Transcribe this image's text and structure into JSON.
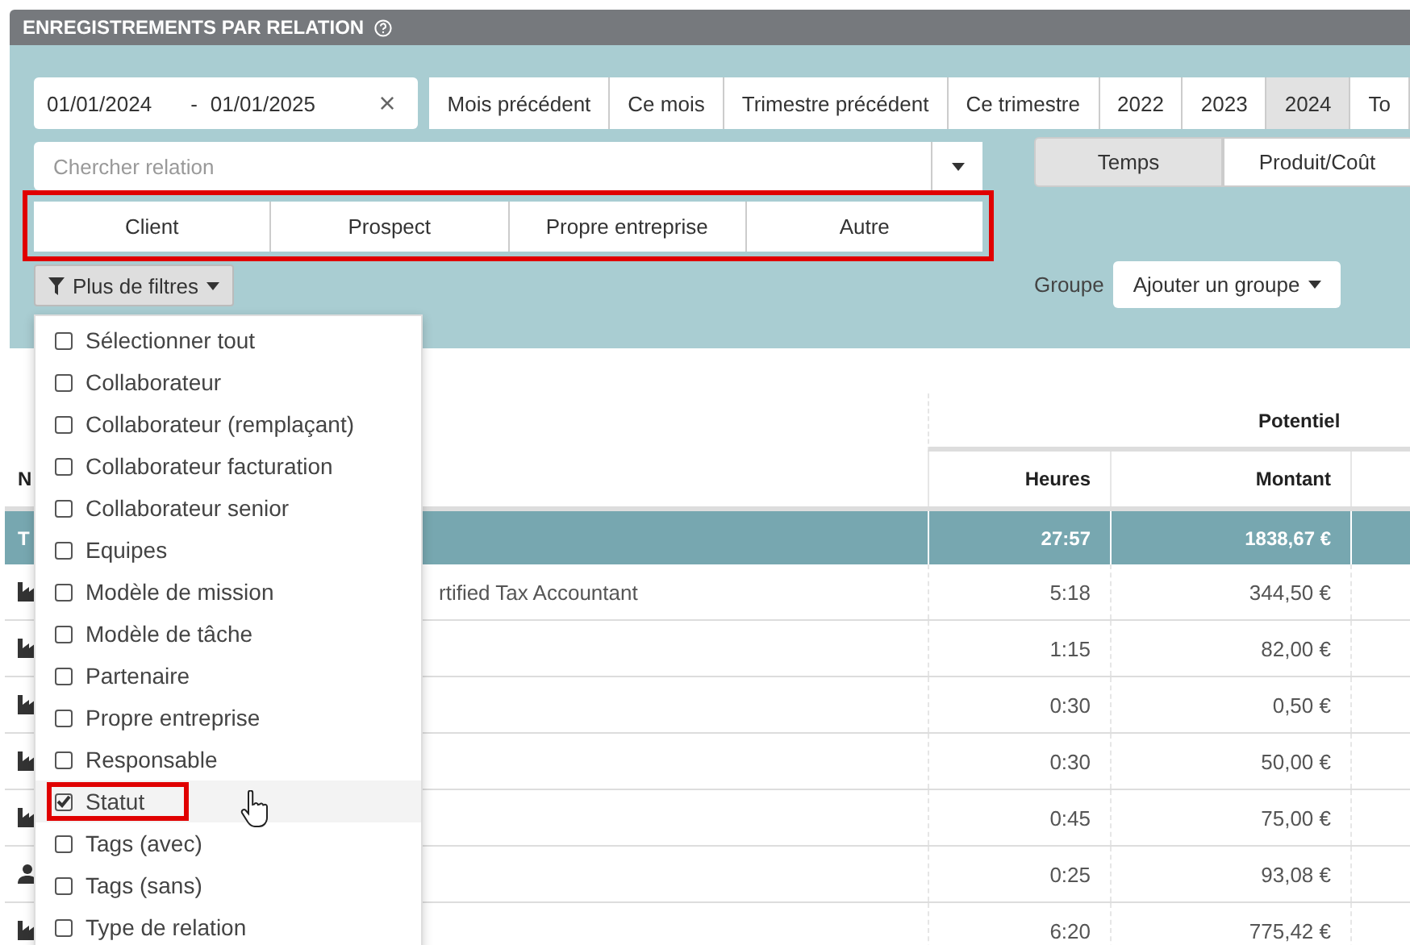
{
  "header": {
    "title": "ENREGISTREMENTS PAR RELATION"
  },
  "date_range": {
    "start": "01/01/2024",
    "separator": "-",
    "end": "01/01/2025",
    "clear": "×"
  },
  "quick_ranges": [
    {
      "label": "Mois précédent",
      "selected": false
    },
    {
      "label": "Ce mois",
      "selected": false
    },
    {
      "label": "Trimestre précédent",
      "selected": false
    },
    {
      "label": "Ce trimestre",
      "selected": false
    },
    {
      "label": "2022",
      "selected": false
    },
    {
      "label": "2023",
      "selected": false
    },
    {
      "label": "2024",
      "selected": true
    },
    {
      "label": "To",
      "selected": false
    }
  ],
  "relation_search": {
    "placeholder": "Chercher relation"
  },
  "view_toggle": [
    {
      "label": "Temps",
      "selected": true
    },
    {
      "label": "Produit/Coût",
      "selected": false
    }
  ],
  "relation_types": {
    "highlighted": true,
    "options": [
      {
        "label": "Client",
        "selected": false
      },
      {
        "label": "Prospect",
        "selected": false
      },
      {
        "label": "Propre entreprise",
        "selected": false
      },
      {
        "label": "Autre",
        "selected": false
      }
    ]
  },
  "more_filters": {
    "label": "Plus de filtres",
    "expanded": true
  },
  "group": {
    "label": "Groupe",
    "button": "Ajouter un groupe"
  },
  "filter_menu": {
    "items": [
      {
        "label": "Sélectionner tout",
        "checked": false,
        "hovered": false,
        "highlighted": false
      },
      {
        "label": "Collaborateur",
        "checked": false,
        "hovered": false,
        "highlighted": false
      },
      {
        "label": "Collaborateur (remplaçant)",
        "checked": false,
        "hovered": false,
        "highlighted": false
      },
      {
        "label": "Collaborateur facturation",
        "checked": false,
        "hovered": false,
        "highlighted": false
      },
      {
        "label": "Collaborateur senior",
        "checked": false,
        "hovered": false,
        "highlighted": false
      },
      {
        "label": "Equipes",
        "checked": false,
        "hovered": false,
        "highlighted": false
      },
      {
        "label": "Modèle de mission",
        "checked": false,
        "hovered": false,
        "highlighted": false
      },
      {
        "label": "Modèle de tâche",
        "checked": false,
        "hovered": false,
        "highlighted": false
      },
      {
        "label": "Partenaire",
        "checked": false,
        "hovered": false,
        "highlighted": false
      },
      {
        "label": "Propre entreprise",
        "checked": false,
        "hovered": false,
        "highlighted": false
      },
      {
        "label": "Responsable",
        "checked": false,
        "hovered": false,
        "highlighted": false
      },
      {
        "label": "Statut",
        "checked": true,
        "hovered": true,
        "highlighted": true
      },
      {
        "label": "Tags (avec)",
        "checked": false,
        "hovered": false,
        "highlighted": false
      },
      {
        "label": "Tags (sans)",
        "checked": false,
        "hovered": false,
        "highlighted": false
      },
      {
        "label": "Type de relation",
        "checked": false,
        "hovered": false,
        "highlighted": false
      }
    ]
  },
  "table": {
    "column_groups": [
      {
        "label": "Potentiel"
      }
    ],
    "columns": [
      "N",
      "Heures",
      "Montant"
    ],
    "total": {
      "label": "T",
      "hours": "27:57",
      "amount": "1838,67 €"
    },
    "rows": [
      {
        "kind": "building",
        "name": "rtified Tax Accountant",
        "hours": "5:18",
        "amount": "344,50 €"
      },
      {
        "kind": "building",
        "hours": "1:15",
        "amount": "82,00 €"
      },
      {
        "kind": "building",
        "hours": "0:30",
        "amount": "0,50 €"
      },
      {
        "kind": "building",
        "hours": "0:30",
        "amount": "50,00 €"
      },
      {
        "kind": "building",
        "hours": "0:45",
        "amount": "75,00 €"
      },
      {
        "kind": "person",
        "hours": "0:25",
        "amount": "93,08 €"
      },
      {
        "kind": "building",
        "hours": "6:20",
        "amount": "775,42 €"
      }
    ]
  }
}
